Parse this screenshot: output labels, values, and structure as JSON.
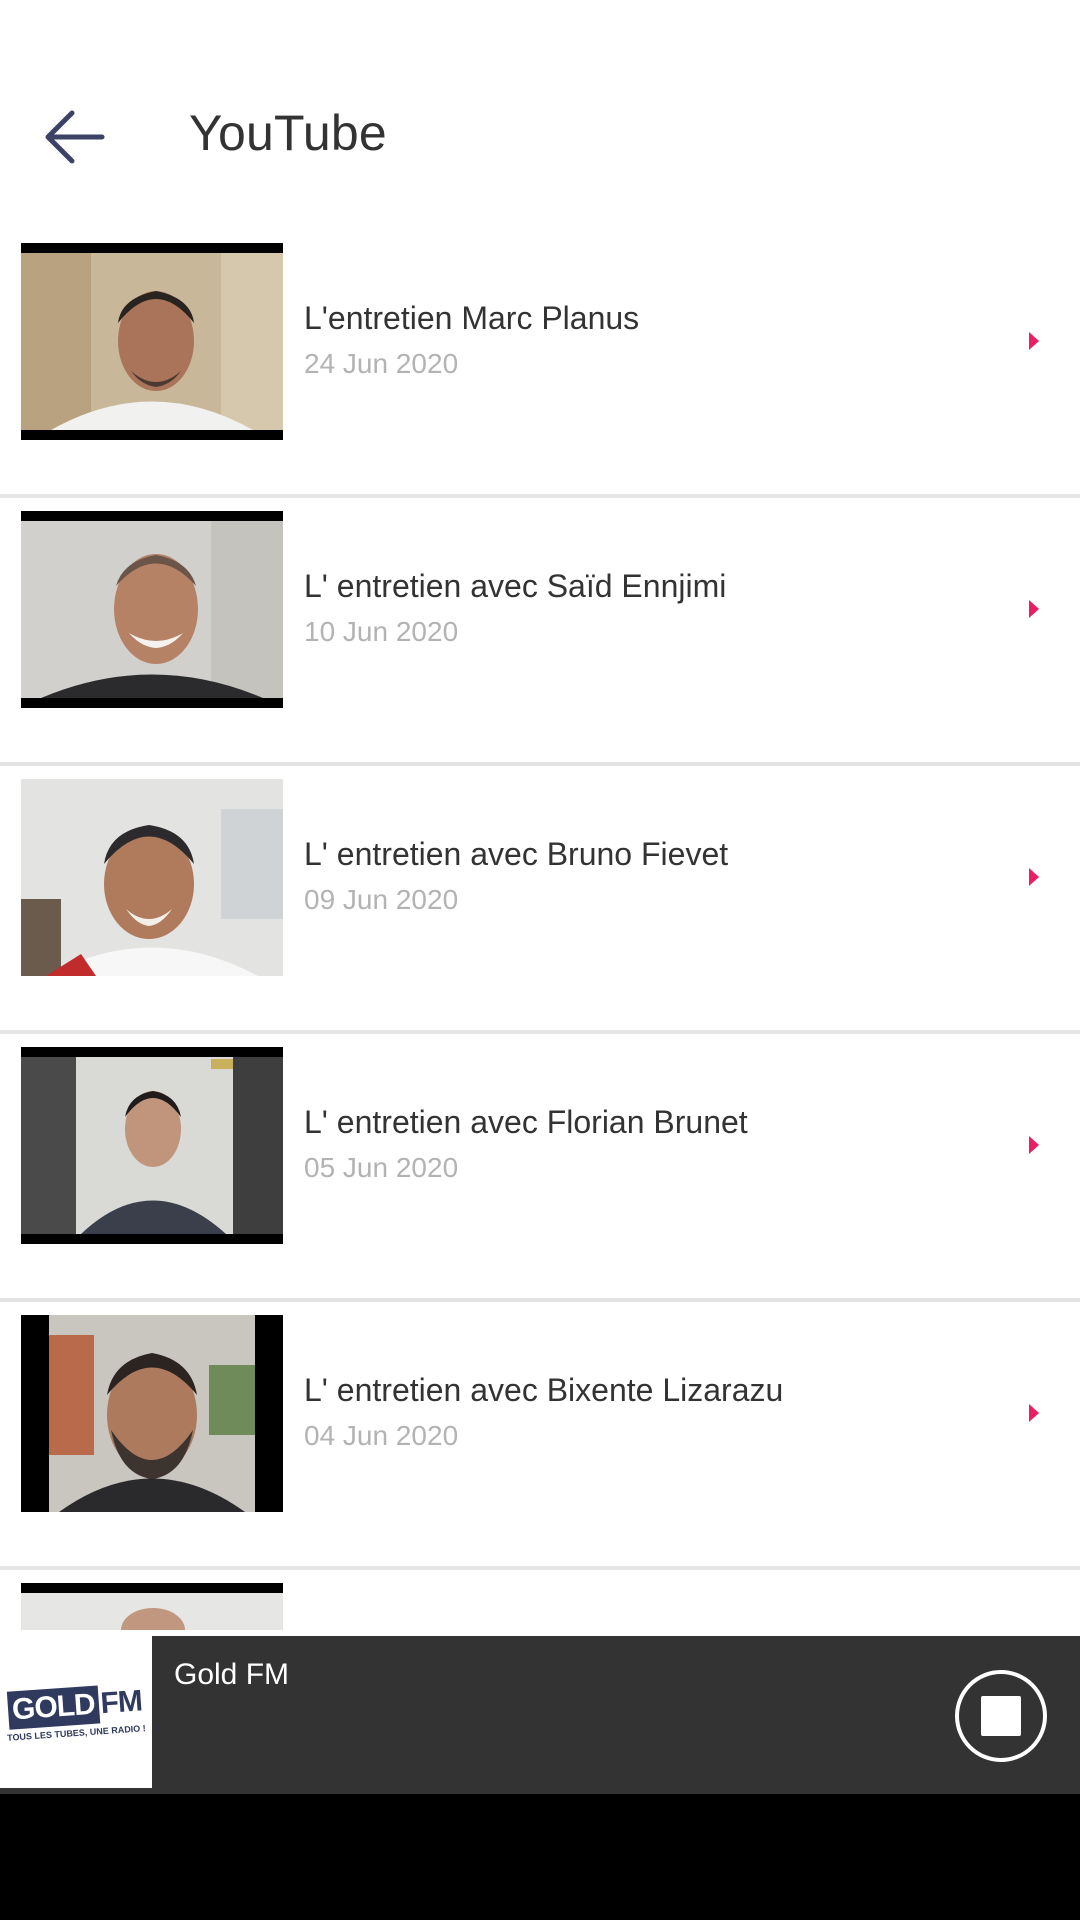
{
  "header": {
    "title": "YouTube",
    "back_icon": "arrow-left-icon"
  },
  "videos": [
    {
      "title": "L'entretien Marc Planus",
      "date": "24 Jun 2020"
    },
    {
      "title": "L' entretien avec Saïd Ennjimi",
      "date": "10 Jun 2020"
    },
    {
      "title": "L' entretien avec Bruno Fievet",
      "date": "09 Jun 2020"
    },
    {
      "title": "L' entretien avec Florian Brunet",
      "date": "05 Jun 2020"
    },
    {
      "title": "L' entretien avec Bixente Lizarazu",
      "date": "04 Jun 2020"
    }
  ],
  "player": {
    "station": "Gold FM",
    "logo_text_1": "GOLD",
    "logo_text_2": "FM",
    "logo_tagline": "TOUS LES TUBES, UNE RADIO !",
    "stop_icon": "stop-icon"
  },
  "colors": {
    "accent": "#e91e63",
    "title_text": "#333333",
    "date_text": "#b3b3b3",
    "player_bg": "#333333",
    "divider": "#e4e4e4",
    "back_arrow": "#3b4266"
  }
}
